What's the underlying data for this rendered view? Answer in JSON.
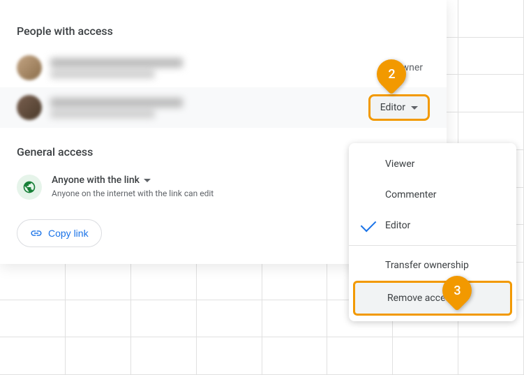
{
  "sections": {
    "people_title": "People with access",
    "general_title": "General access"
  },
  "people": [
    {
      "role": "Owner"
    },
    {
      "role": "Editor"
    }
  ],
  "general": {
    "link_label": "Anyone with the link",
    "link_description": "Anyone on the internet with the link can edit"
  },
  "buttons": {
    "copy_link": "Copy link"
  },
  "menu": {
    "viewer": "Viewer",
    "commenter": "Commenter",
    "editor": "Editor",
    "transfer": "Transfer ownership",
    "remove": "Remove access"
  },
  "callouts": {
    "step2": "2",
    "step3": "3"
  }
}
